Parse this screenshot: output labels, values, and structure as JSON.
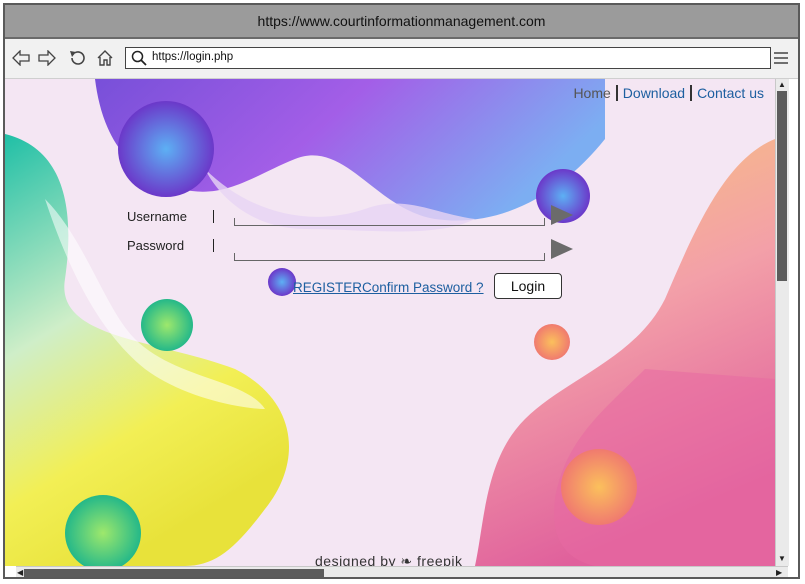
{
  "browser": {
    "title": "https://www.courtinformationmanagement.com",
    "address_url": "https://login.php"
  },
  "nav": {
    "home": "Home",
    "download": "Download",
    "contact": "Contact us"
  },
  "form": {
    "username_label": "Username",
    "password_label": "Password",
    "register_link": "REGISTER",
    "confirm_link": "Confirm Password ?",
    "login_button": "Login"
  },
  "footer": {
    "credit": "designed by ❧ freepik"
  },
  "colors": {
    "nav_active": "#555555",
    "link": "#1d5fa0"
  }
}
